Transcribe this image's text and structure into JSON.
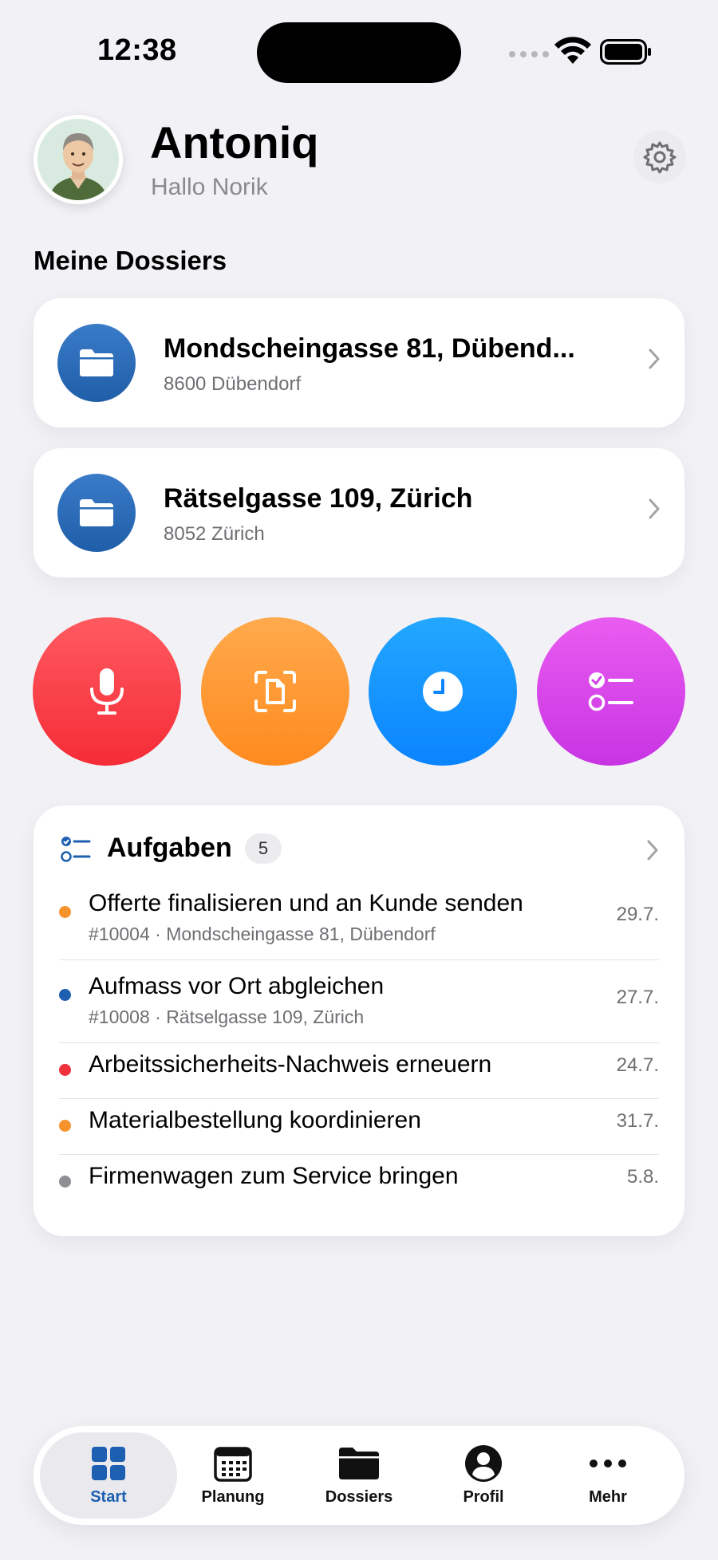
{
  "status_bar": {
    "time": "12:38"
  },
  "header": {
    "app_title": "Antoniq",
    "greeting": "Hallo Norik"
  },
  "dossiers": {
    "section_title": "Meine Dossiers",
    "items": [
      {
        "title": "Mondscheingasse 81, Dübend...",
        "subtitle": "8600 Dübendorf"
      },
      {
        "title": "Rätselgasse 109, Zürich",
        "subtitle": "8052 Zürich"
      }
    ]
  },
  "quick_actions": [
    {
      "icon": "microphone-icon",
      "color": "#f52c37"
    },
    {
      "icon": "document-scan-icon",
      "color": "#ff8a1e"
    },
    {
      "icon": "clock-icon",
      "color": "#0a84ff"
    },
    {
      "icon": "checklist-icon",
      "color": "#c834e3"
    }
  ],
  "tasks": {
    "title": "Aufgaben",
    "count": "5",
    "items": [
      {
        "title": "Offerte finalisieren und an Kunde senden",
        "meta": "#10004 · Mondscheingasse 81, Dübendorf",
        "date": "29.7.",
        "dot_color": "#f5922b"
      },
      {
        "title": "Aufmass vor Ort abgleichen",
        "meta": "#10008 · Rätselgasse 109, Zürich",
        "date": "27.7.",
        "dot_color": "#1d5fb0"
      },
      {
        "title": "Arbeitssicherheits-Nachweis erneuern",
        "meta": "",
        "date": "24.7.",
        "dot_color": "#f0323c"
      },
      {
        "title": "Materialbestellung koordinieren",
        "meta": "",
        "date": "31.7.",
        "dot_color": "#f5922b"
      },
      {
        "title": "Firmenwagen zum Service bringen",
        "meta": "",
        "date": "5.8.",
        "dot_color": "#8e8e93"
      }
    ]
  },
  "tab_bar": {
    "items": [
      {
        "label": "Start",
        "icon": "grid-icon",
        "active": true
      },
      {
        "label": "Planung",
        "icon": "calendar-icon",
        "active": false
      },
      {
        "label": "Dossiers",
        "icon": "folder-icon",
        "active": false
      },
      {
        "label": "Profil",
        "icon": "person-icon",
        "active": false
      },
      {
        "label": "Mehr",
        "icon": "ellipsis-icon",
        "active": false
      }
    ]
  },
  "colors": {
    "accent": "#1d5fb0",
    "background": "#f2f2f6"
  }
}
